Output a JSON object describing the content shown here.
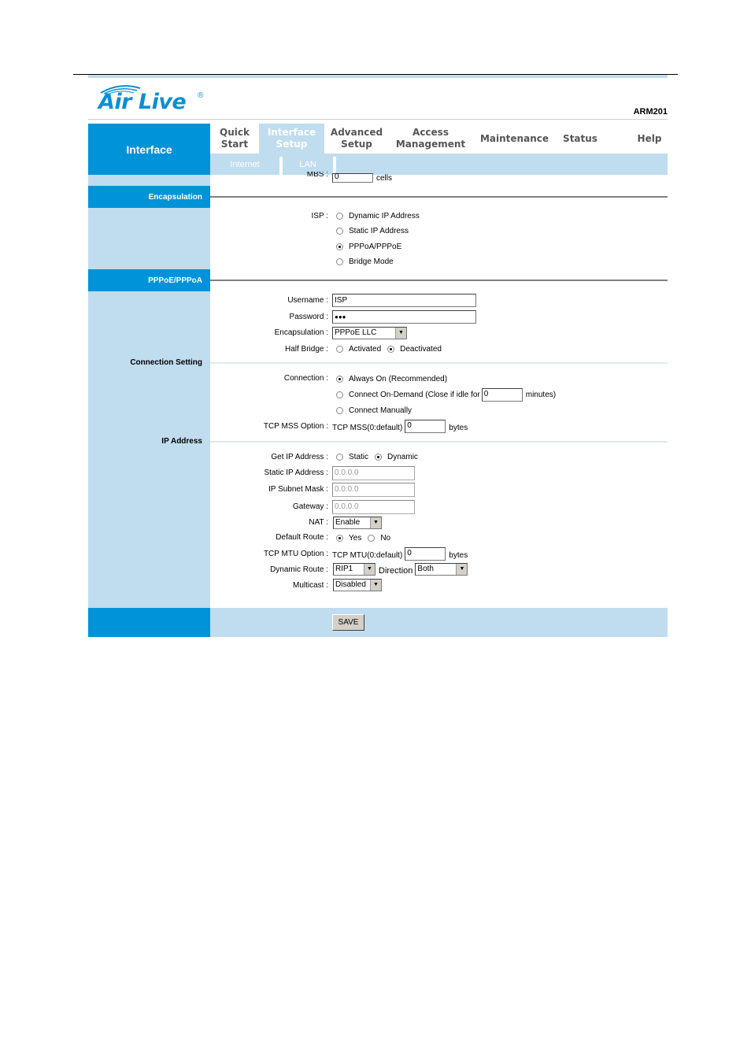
{
  "header": {
    "logo_text": "Air Live",
    "logo_reg": "®",
    "model": "ARM201",
    "section_title": "Interface"
  },
  "nav": {
    "items": [
      {
        "label": "Quick\nStart",
        "line1": "Quick",
        "line2": "Start",
        "active": false
      },
      {
        "label": "Interface Setup",
        "line1": "Interface",
        "line2": "Setup",
        "active": true
      },
      {
        "label": "Advanced Setup",
        "line1": "Advanced",
        "line2": "Setup",
        "active": false
      },
      {
        "label": "Access Management",
        "line1": "Access",
        "line2": "Management",
        "active": false
      },
      {
        "label": "Maintenance",
        "line1": "Maintenance",
        "line2": "",
        "active": false
      },
      {
        "label": "Status",
        "line1": "Status",
        "line2": "",
        "active": false
      },
      {
        "label": "Help",
        "line1": "Help",
        "line2": "",
        "active": false
      }
    ],
    "subitems": [
      {
        "label": "Internet"
      },
      {
        "label": "LAN"
      }
    ]
  },
  "mbs": {
    "label": "MBS :",
    "value": "0",
    "unit": "cells"
  },
  "sections": {
    "encapsulation": "Encapsulation",
    "pppoe": "PPPoE/PPPoA",
    "connection_setting": "Connection Setting",
    "ip_address": "IP Address"
  },
  "isp": {
    "label": "ISP :",
    "options": [
      {
        "label": "Dynamic IP Address",
        "selected": false
      },
      {
        "label": "Static IP Address",
        "selected": false
      },
      {
        "label": "PPPoA/PPPoE",
        "selected": true
      },
      {
        "label": "Bridge Mode",
        "selected": false
      }
    ]
  },
  "pppoe": {
    "username_label": "Username :",
    "username": "ISP",
    "password_label": "Password :",
    "password": "●●●",
    "encapsulation_label": "Encapsulation :",
    "encapsulation": "PPPoE LLC",
    "half_bridge_label": "Half Bridge :",
    "half_bridge_options": [
      {
        "label": "Activated",
        "selected": false
      },
      {
        "label": "Deactivated",
        "selected": true
      }
    ]
  },
  "connection": {
    "label": "Connection :",
    "always_on": "Always On (Recommended)",
    "on_demand_prefix": "Connect On-Demand (Close if idle for",
    "on_demand_value": "0",
    "on_demand_suffix": "minutes)",
    "manual": "Connect Manually",
    "selected": "always_on",
    "tcp_mss_label": "TCP MSS Option :",
    "tcp_mss_prefix": "TCP MSS(0:default)",
    "tcp_mss_value": "0",
    "tcp_mss_unit": "bytes"
  },
  "ip": {
    "get_ip_label": "Get IP Address :",
    "get_ip_options": [
      {
        "label": "Static",
        "selected": false
      },
      {
        "label": "Dynamic",
        "selected": true
      }
    ],
    "static_ip_label": "Static IP Address :",
    "static_ip": "0.0.0.0",
    "subnet_label": "IP Subnet Mask :",
    "subnet": "0.0.0.0",
    "gateway_label": "Gateway :",
    "gateway": "0.0.0.0",
    "nat_label": "NAT :",
    "nat": "Enable",
    "default_route_label": "Default Route :",
    "default_route_options": [
      {
        "label": "Yes",
        "selected": true
      },
      {
        "label": "No",
        "selected": false
      }
    ],
    "tcp_mtu_label": "TCP MTU Option :",
    "tcp_mtu_prefix": "TCP MTU(0:default)",
    "tcp_mtu_value": "0",
    "tcp_mtu_unit": "bytes",
    "dynamic_route_label": "Dynamic Route :",
    "dynamic_route": "RIP1",
    "direction_label": "Direction",
    "direction": "Both",
    "multicast_label": "Multicast :",
    "multicast": "Disabled"
  },
  "footer": {
    "save_label": "SAVE"
  },
  "colors": {
    "brand_blue": "#0093d9",
    "light_blue": "#c0dcef"
  }
}
